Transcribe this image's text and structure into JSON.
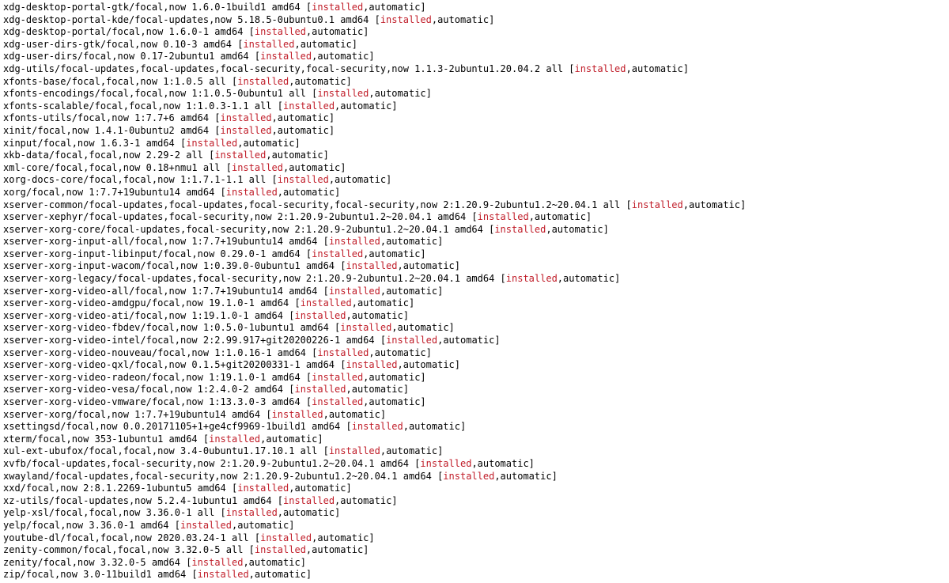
{
  "terminal": {
    "installed_label": "installed",
    "auto_suffix": ",automatic]",
    "packages": [
      {
        "pre": "xdg-desktop-portal-gtk/focal,now 1.6.0-1build1 amd64 ["
      },
      {
        "pre": "xdg-desktop-portal-kde/focal-updates,now 5.18.5-0ubuntu0.1 amd64 ["
      },
      {
        "pre": "xdg-desktop-portal/focal,now 1.6.0-1 amd64 ["
      },
      {
        "pre": "xdg-user-dirs-gtk/focal,now 0.10-3 amd64 ["
      },
      {
        "pre": "xdg-user-dirs/focal,now 0.17-2ubuntu1 amd64 ["
      },
      {
        "pre": "xdg-utils/focal-updates,focal-updates,focal-security,focal-security,now 1.1.3-2ubuntu1.20.04.2 all ["
      },
      {
        "pre": "xfonts-base/focal,focal,now 1:1.0.5 all ["
      },
      {
        "pre": "xfonts-encodings/focal,focal,now 1:1.0.5-0ubuntu1 all ["
      },
      {
        "pre": "xfonts-scalable/focal,focal,now 1:1.0.3-1.1 all ["
      },
      {
        "pre": "xfonts-utils/focal,now 1:7.7+6 amd64 ["
      },
      {
        "pre": "xinit/focal,now 1.4.1-0ubuntu2 amd64 ["
      },
      {
        "pre": "xinput/focal,now 1.6.3-1 amd64 ["
      },
      {
        "pre": "xkb-data/focal,focal,now 2.29-2 all ["
      },
      {
        "pre": "xml-core/focal,focal,now 0.18+nmu1 all ["
      },
      {
        "pre": "xorg-docs-core/focal,focal,now 1:1.7.1-1.1 all ["
      },
      {
        "pre": "xorg/focal,now 1:7.7+19ubuntu14 amd64 ["
      },
      {
        "pre": "xserver-common/focal-updates,focal-updates,focal-security,focal-security,now 2:1.20.9-2ubuntu1.2~20.04.1 all ["
      },
      {
        "pre": "xserver-xephyr/focal-updates,focal-security,now 2:1.20.9-2ubuntu1.2~20.04.1 amd64 ["
      },
      {
        "pre": "xserver-xorg-core/focal-updates,focal-security,now 2:1.20.9-2ubuntu1.2~20.04.1 amd64 ["
      },
      {
        "pre": "xserver-xorg-input-all/focal,now 1:7.7+19ubuntu14 amd64 ["
      },
      {
        "pre": "xserver-xorg-input-libinput/focal,now 0.29.0-1 amd64 ["
      },
      {
        "pre": "xserver-xorg-input-wacom/focal,now 1:0.39.0-0ubuntu1 amd64 ["
      },
      {
        "pre": "xserver-xorg-legacy/focal-updates,focal-security,now 2:1.20.9-2ubuntu1.2~20.04.1 amd64 ["
      },
      {
        "pre": "xserver-xorg-video-all/focal,now 1:7.7+19ubuntu14 amd64 ["
      },
      {
        "pre": "xserver-xorg-video-amdgpu/focal,now 19.1.0-1 amd64 ["
      },
      {
        "pre": "xserver-xorg-video-ati/focal,now 1:19.1.0-1 amd64 ["
      },
      {
        "pre": "xserver-xorg-video-fbdev/focal,now 1:0.5.0-1ubuntu1 amd64 ["
      },
      {
        "pre": "xserver-xorg-video-intel/focal,now 2:2.99.917+git20200226-1 amd64 ["
      },
      {
        "pre": "xserver-xorg-video-nouveau/focal,now 1:1.0.16-1 amd64 ["
      },
      {
        "pre": "xserver-xorg-video-qxl/focal,now 0.1.5+git20200331-1 amd64 ["
      },
      {
        "pre": "xserver-xorg-video-radeon/focal,now 1:19.1.0-1 amd64 ["
      },
      {
        "pre": "xserver-xorg-video-vesa/focal,now 1:2.4.0-2 amd64 ["
      },
      {
        "pre": "xserver-xorg-video-vmware/focal,now 1:13.3.0-3 amd64 ["
      },
      {
        "pre": "xserver-xorg/focal,now 1:7.7+19ubuntu14 amd64 ["
      },
      {
        "pre": "xsettingsd/focal,now 0.0.20171105+1+ge4cf9969-1build1 amd64 ["
      },
      {
        "pre": "xterm/focal,now 353-1ubuntu1 amd64 ["
      },
      {
        "pre": "xul-ext-ubufox/focal,focal,now 3.4-0ubuntu1.17.10.1 all ["
      },
      {
        "pre": "xvfb/focal-updates,focal-security,now 2:1.20.9-2ubuntu1.2~20.04.1 amd64 ["
      },
      {
        "pre": "xwayland/focal-updates,focal-security,now 2:1.20.9-2ubuntu1.2~20.04.1 amd64 ["
      },
      {
        "pre": "xxd/focal,now 2:8.1.2269-1ubuntu5 amd64 ["
      },
      {
        "pre": "xz-utils/focal-updates,now 5.2.4-1ubuntu1 amd64 ["
      },
      {
        "pre": "yelp-xsl/focal,focal,now 3.36.0-1 all ["
      },
      {
        "pre": "yelp/focal,now 3.36.0-1 amd64 ["
      },
      {
        "pre": "youtube-dl/focal,focal,now 2020.03.24-1 all ["
      },
      {
        "pre": "zenity-common/focal,focal,now 3.32.0-5 all ["
      },
      {
        "pre": "zenity/focal,now 3.32.0-5 amd64 ["
      },
      {
        "pre": "zip/focal,now 3.0-11build1 amd64 ["
      }
    ]
  }
}
